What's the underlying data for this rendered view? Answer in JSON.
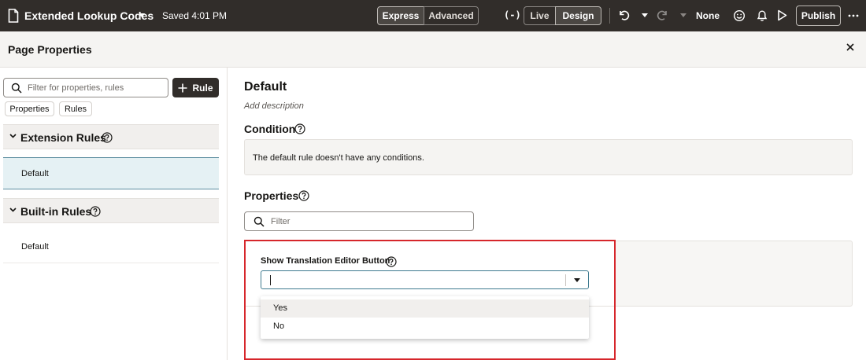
{
  "topbar": {
    "title": "Extended Lookup Codes",
    "saved": "Saved 4:01 PM",
    "modes": [
      "Express",
      "Advanced"
    ],
    "active_mode": "Express",
    "variable_icon": "(-)",
    "views": [
      "Live",
      "Design"
    ],
    "active_view": "Design",
    "scope": "None",
    "publish_label": "Publish",
    "icons": [
      "document-icon",
      "undo-icon",
      "redo-icon",
      "smile-icon",
      "bell-icon",
      "play-icon",
      "more-icon"
    ]
  },
  "header": {
    "title": "Page Properties"
  },
  "left": {
    "search_placeholder": "Filter for properties, rules",
    "add_rule_label": "Rule",
    "chips": [
      "Properties",
      "Rules"
    ],
    "sections": [
      {
        "title": "Extension Rules",
        "items": [
          "Default"
        ]
      },
      {
        "title": "Built-in Rules",
        "items": [
          "Default"
        ]
      }
    ]
  },
  "right": {
    "rule_title": "Default",
    "add_description": "Add description",
    "condition_heading": "Condition",
    "condition_text": "The default rule doesn't have any conditions.",
    "properties_heading": "Properties",
    "filter_placeholder": "Filter",
    "property": {
      "label": "Show Translation Editor Button",
      "value": "",
      "options": [
        "Yes",
        "No"
      ],
      "hovered_option": "Yes"
    }
  },
  "colors": {
    "topbar_bg": "#312d2a",
    "highlight": "#d6262b",
    "selected_row": "#e5f1f4",
    "focus_border": "#3e7a8f"
  }
}
